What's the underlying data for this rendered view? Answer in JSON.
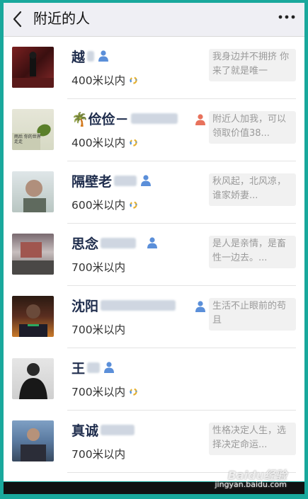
{
  "header": {
    "title": "附近的人"
  },
  "rows": [
    {
      "name": "越",
      "distance": "400米以内",
      "signature": "我身边并不拥挤 你来了就是唯一",
      "show_ring": true
    },
    {
      "name": "🌴俭俭－",
      "distance": "400米以内",
      "signature": "附近人加我，可以领取价值38...",
      "show_ring": true,
      "avatar_text": "雨后 你的世界 走走"
    },
    {
      "name": "隔壁老",
      "distance": "600米以内",
      "signature": "秋风起，北风凉，谁家娇妻...",
      "show_ring": true
    },
    {
      "name": "思念",
      "distance": "700米以内",
      "signature": "是人是亲情，是畜性一边去。...",
      "show_ring": false
    },
    {
      "name": "沈阳",
      "distance": "700米以内",
      "signature": "生活不止眼前的苟且",
      "show_ring": false
    },
    {
      "name": "王",
      "distance": "700米以内",
      "signature": "",
      "show_ring": true
    },
    {
      "name": "真诚",
      "distance": "700米以内",
      "signature": "性格决定人生，选择决定命运...",
      "show_ring": false
    }
  ],
  "watermark": {
    "brand": "Baidu经验",
    "url": "jingyan.baidu.com"
  },
  "colors": {
    "frame": "#19a89c",
    "male_icon": "#5b8fd9",
    "female_icon": "#e8725c"
  }
}
